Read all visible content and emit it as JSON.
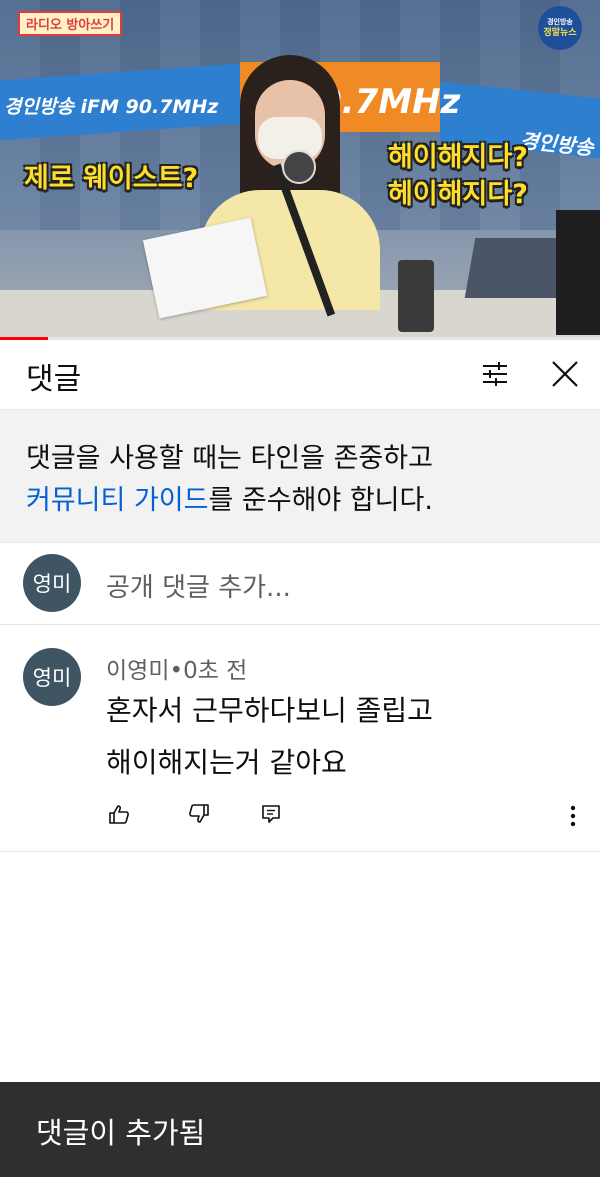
{
  "video": {
    "program_tag": "라디오 방아쓰기",
    "channel_logo_top": "경인방송",
    "channel_logo_bottom": "정말뉴스",
    "banner_left": "경인방송 iFM 90.7MHz",
    "banner_mid": "0.7MHz",
    "banner_right": "경인방송",
    "caption_left": "제로 웨이스트?",
    "caption_right_1": "해이해지다?",
    "caption_right_2": "헤이해지다?",
    "progress": 0.08,
    "progress_color": "#ff0000"
  },
  "header": {
    "title": "댓글",
    "filter_icon": "sliders-icon",
    "close_icon": "close-icon"
  },
  "notice": {
    "text_before": "댓글을 사용할 때는 타인을 존중하고",
    "link_text": "커뮤니티 가이드",
    "text_after": "를 준수해야 합니다.",
    "link_color": "#065fd4"
  },
  "add_comment": {
    "avatar_text": "영미",
    "placeholder": "공개 댓글 추가..."
  },
  "comment": {
    "avatar_text": "영미",
    "author": "이영미",
    "separator": "•",
    "time": "0초 전",
    "body_line1": "혼자서 근무하다보니 졸립고",
    "body_line2": "해이해지는거 같아요",
    "like_icon": "thumbs-up-icon",
    "dislike_icon": "thumbs-down-icon",
    "reply_icon": "reply-icon",
    "more_icon": "more-vertical-icon"
  },
  "snackbar": {
    "text": "댓글이 추가됨"
  }
}
